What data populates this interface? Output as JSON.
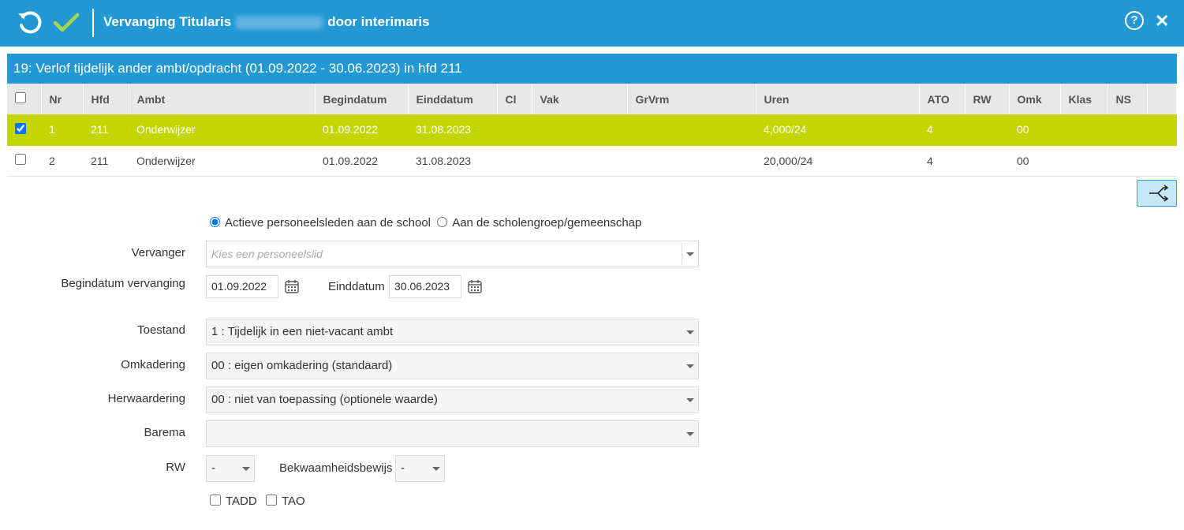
{
  "header": {
    "title_prefix": "Vervanging Titularis",
    "title_suffix": "door interimaris",
    "help_glyph": "?",
    "close_glyph": "✕",
    "accent_color": "#2299d4"
  },
  "section": {
    "title": "19: Verlof tijdelijk ander ambt/opdracht (01.09.2022 - 30.06.2023) in hfd 211"
  },
  "table": {
    "columns": [
      "Nr",
      "Hfd",
      "Ambt",
      "Begindatum",
      "Einddatum",
      "Cl",
      "Vak",
      "GrVrm",
      "Uren",
      "ATO",
      "RW",
      "Omk",
      "Klas",
      "NS"
    ],
    "rows": [
      {
        "checked": true,
        "nr": "1",
        "hfd": "211",
        "ambt": "Onderwijzer",
        "begindatum": "01.09.2022",
        "einddatum": "31.08.2023",
        "cl": "",
        "vak": "",
        "grvrm": "",
        "uren": "4,000/24",
        "ato": "4",
        "rw": "",
        "omk": "00",
        "klas": "",
        "ns": ""
      },
      {
        "checked": false,
        "nr": "2",
        "hfd": "211",
        "ambt": "Onderwijzer",
        "begindatum": "01.09.2022",
        "einddatum": "31.08.2023",
        "cl": "",
        "vak": "",
        "grvrm": "",
        "uren": "20,000/24",
        "ato": "4",
        "rw": "",
        "omk": "00",
        "klas": "",
        "ns": ""
      }
    ],
    "selected_color": "#c4d600"
  },
  "form": {
    "radio_active": "Actieve personeelsleden aan de school",
    "radio_group": "Aan de scholengroep/gemeenschap",
    "vervanger_label": "Vervanger",
    "vervanger_placeholder": "Kies een personeelslid",
    "begindatum_label": "Begindatum vervanging",
    "begindatum_value": "01.09.2022",
    "einddatum_label": "Einddatum",
    "einddatum_value": "30.06.2023",
    "toestand_label": "Toestand",
    "toestand_value": "1 : Tijdelijk in een niet-vacant ambt",
    "omkadering_label": "Omkadering",
    "omkadering_value": "00 : eigen omkadering (standaard)",
    "herwaardering_label": "Herwaardering",
    "herwaardering_value": "00 : niet van toepassing (optionele waarde)",
    "barema_label": "Barema",
    "barema_value": "",
    "rw_label": "RW",
    "rw_value": "-",
    "bekwaamheid_label": "Bekwaamheidsbewijs",
    "bekwaamheid_value": "-",
    "tadd_label": "TADD",
    "tao_label": "TAO"
  }
}
